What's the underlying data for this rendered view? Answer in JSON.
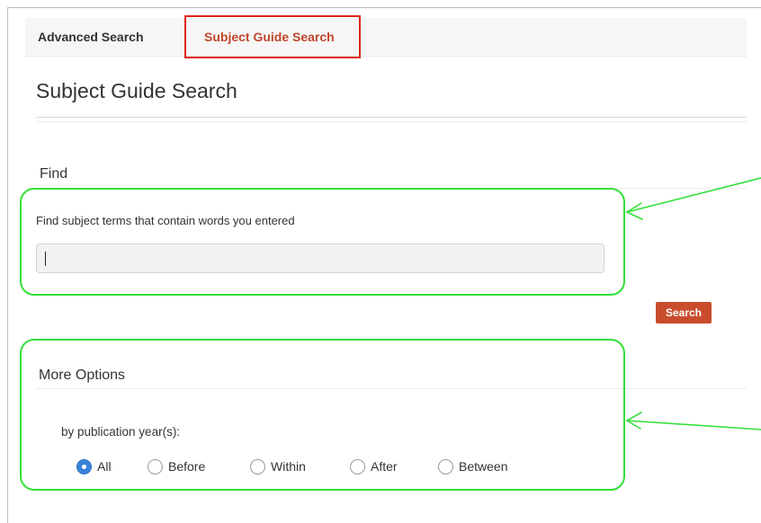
{
  "tabs": {
    "advanced_label": "Advanced Search",
    "subject_label": "Subject Guide Search"
  },
  "page": {
    "title": "Subject Guide Search"
  },
  "find": {
    "heading": "Find",
    "label": "Find subject terms that contain words you entered",
    "input_value": "",
    "search_button_label": "Search"
  },
  "more_options": {
    "heading": "More Options",
    "year_label": "by publication year(s):",
    "options": [
      "All",
      "Before",
      "Within",
      "After",
      "Between"
    ],
    "selected": "All"
  },
  "colors": {
    "active_tab": "#c0462a",
    "tab_highlight": "#e0201c",
    "search_button": "#c94c2c",
    "radio_checked": "#3b83d9",
    "annotation": "#33e03a"
  }
}
